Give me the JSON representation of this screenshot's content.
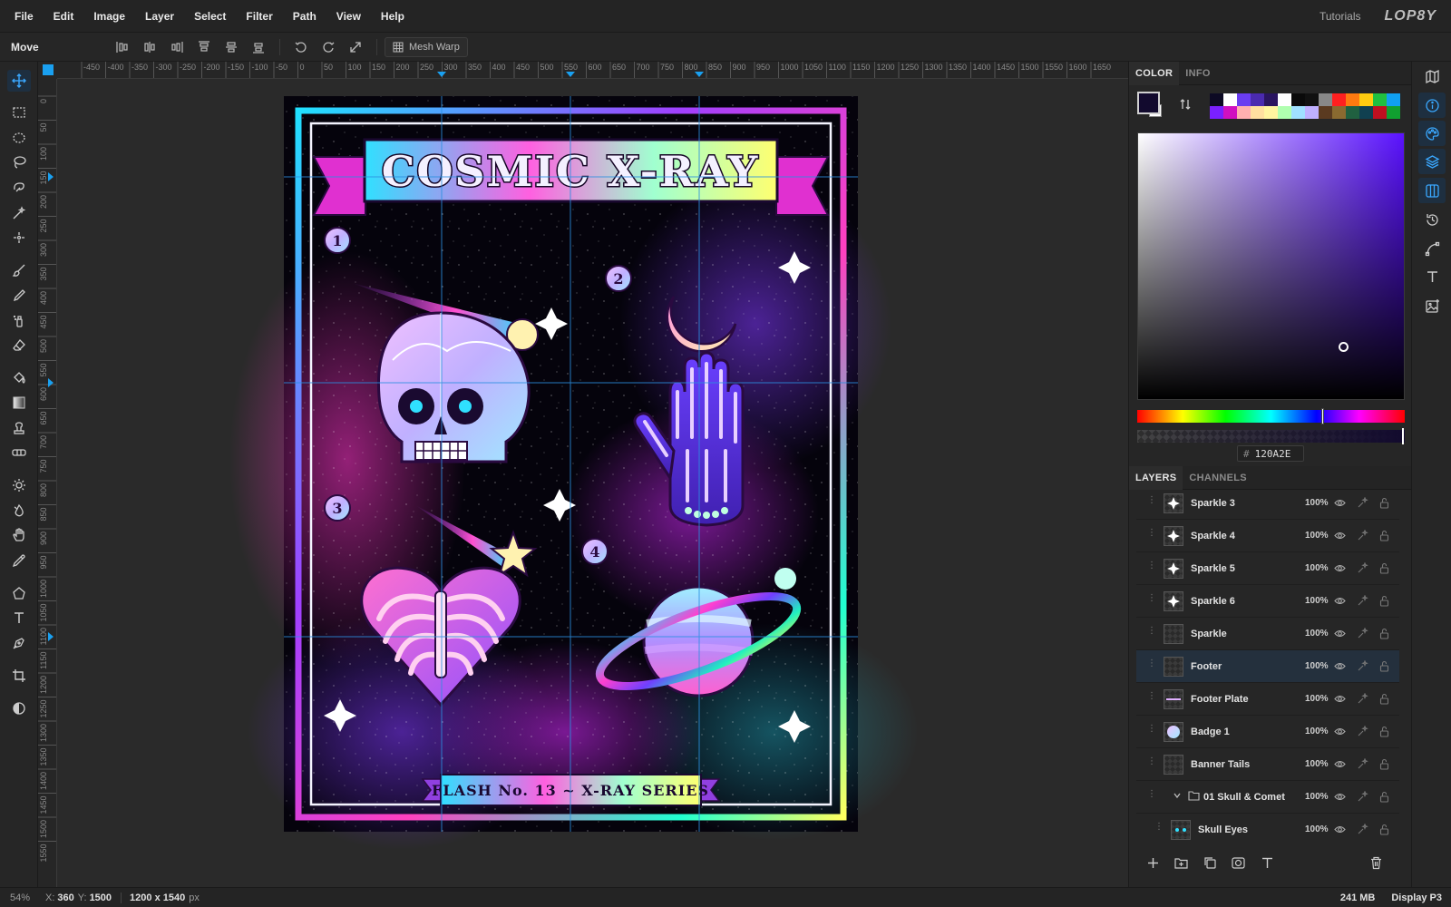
{
  "menu": {
    "items": [
      "File",
      "Edit",
      "Image",
      "Layer",
      "Select",
      "Filter",
      "Path",
      "View",
      "Help"
    ],
    "tutorials": "Tutorials",
    "logo": "LOP8Y"
  },
  "tool_options": {
    "tool_name": "Move",
    "mesh_warp_label": "Mesh Warp"
  },
  "ruler": {
    "top_labels": [
      "-450",
      "-400",
      "-350",
      "-300",
      "-250",
      "-200",
      "-150",
      "-100",
      "-50",
      "0",
      "50",
      "100",
      "150",
      "200",
      "250",
      "300",
      "350",
      "400",
      "450",
      "500",
      "550",
      "600",
      "650",
      "700",
      "750",
      "800",
      "850",
      "900",
      "950",
      "1000",
      "1050",
      "1100",
      "1150",
      "1200",
      "1250",
      "1300",
      "1350",
      "1400",
      "1450",
      "1500",
      "1550",
      "1600",
      "1650"
    ],
    "left_labels": [
      "0",
      "50",
      "100",
      "150",
      "200",
      "250",
      "300",
      "350",
      "400",
      "450",
      "500",
      "550",
      "600",
      "650",
      "700",
      "750",
      "800",
      "850",
      "900",
      "950",
      "1000",
      "1050",
      "1100",
      "1150",
      "1200",
      "1250",
      "1300",
      "1350",
      "1400",
      "1450",
      "1500",
      "1550"
    ]
  },
  "artwork": {
    "title": "COSMIC X-RAY",
    "footer": "FLASH No. 13  ~  X-RAY SERIES",
    "badges": [
      "1",
      "2",
      "3",
      "4"
    ]
  },
  "panel": {
    "color_tab": "COLOR",
    "info_tab": "INFO",
    "foreground_color": "#120A2E",
    "hex_value": "120A2E",
    "hex_hash": "#",
    "palette": [
      "#0d0a24",
      "#ffffff",
      "#6a3df0",
      "#4a2ab0",
      "#2a1560",
      "#ffffff",
      "#0a0a0a",
      "#111111",
      "#888888",
      "#ff2020",
      "#ff7a10",
      "#ffcc10",
      "#20c040",
      "#10a0f0",
      "#7a20ff",
      "#d010c0",
      "#ffb0b0",
      "#ffe0a0",
      "#fff5a0",
      "#b0ffb0",
      "#a0e0ff",
      "#c0b0ff",
      "#5a3a20",
      "#8a6a30",
      "#206040",
      "#104050",
      "#c01020",
      "#10a030"
    ],
    "layers_tab": "LAYERS",
    "channels_tab": "CHANNELS",
    "layers": [
      {
        "name": "Sparkle 3",
        "opacity": "100%",
        "thumb": "sparkle"
      },
      {
        "name": "Sparkle 4",
        "opacity": "100%",
        "thumb": "sparkle"
      },
      {
        "name": "Sparkle 5",
        "opacity": "100%",
        "thumb": "sparkle"
      },
      {
        "name": "Sparkle 6",
        "opacity": "100%",
        "thumb": "sparkle"
      },
      {
        "name": "Sparkle",
        "opacity": "100%",
        "thumb": "empty"
      },
      {
        "name": "Footer",
        "opacity": "100%",
        "thumb": "empty",
        "selected": true
      },
      {
        "name": "Footer Plate",
        "opacity": "100%",
        "thumb": "line"
      },
      {
        "name": "Badge 1",
        "opacity": "100%",
        "thumb": "circle"
      },
      {
        "name": "Banner Tails",
        "opacity": "100%",
        "thumb": "empty"
      },
      {
        "name": "01 Skull & Comet",
        "opacity": "100%",
        "thumb": "folder",
        "group": true
      },
      {
        "name": "Skull Eyes",
        "opacity": "100%",
        "thumb": "eyes",
        "child": true
      }
    ]
  },
  "status": {
    "zoom": "54%",
    "x_label": "X:",
    "x_value": "360",
    "y_label": "Y:",
    "y_value": "1500",
    "doc_size": "1200 x 1540",
    "doc_unit": "px",
    "memory": "241 MB",
    "color_profile": "Display P3"
  }
}
